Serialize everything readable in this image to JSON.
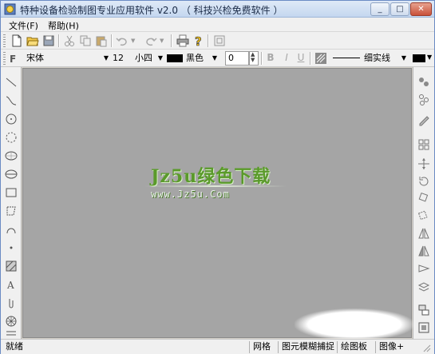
{
  "window": {
    "title": "特种设备检验制图专业应用软件 v2.0 （ 科技兴检免费软件 ）",
    "buttons": {
      "minimize": "_",
      "maximize": "□",
      "close": "✕"
    }
  },
  "menu": {
    "items": [
      {
        "label": "文件(F)"
      },
      {
        "label": "帮助(H)"
      }
    ]
  },
  "toolbar1": {
    "icons": [
      "new-file-icon",
      "open-folder-icon",
      "save-icon",
      "cut-icon",
      "copy-icon",
      "paste-icon",
      "undo-icon",
      "undo-dropdown-icon",
      "redo-icon",
      "redo-dropdown-icon",
      "print-icon",
      "help-icon",
      "page-icon"
    ]
  },
  "toolbar2": {
    "font_name": "宋体",
    "font_size": "12",
    "font_size_name": "小四",
    "color_name": "黑色",
    "spacing_value": "0",
    "bold_label": "B",
    "italic_label": "I",
    "underline_label": "U",
    "line_style": "细实线"
  },
  "canvas": {
    "background": "#a5a5a5",
    "watermark_main": "Jz5u绿色下载",
    "watermark_sub": "www.Jz5u.Com",
    "watermark_color": "#5a9a2a"
  },
  "left_palette": {
    "tools": [
      "line-tool-icon",
      "curve-tool-icon",
      "circle-tool-icon",
      "dashed-circle-tool-icon",
      "ellipse-tool-icon",
      "arc-ellipse-tool-icon",
      "rectangle-tool-icon",
      "polygon-tool-icon",
      "arc-tool-icon",
      "point-tool-icon",
      "hatch-tool-icon",
      "text-tool-icon",
      "clip-tool-icon",
      "wheel-tool-icon",
      "grid-tool-icon"
    ]
  },
  "right_palette": {
    "tools": [
      "scatter-icon",
      "nodes-icon",
      "pencil-icon",
      "align-grid-icon",
      "move-icon",
      "rotate-icon",
      "rotate-alt-icon",
      "mirror-icon",
      "mirror-alt-icon",
      "flip-icon",
      "flip-alt-icon",
      "layers-icon",
      "stack-icon",
      "array-icon"
    ]
  },
  "status": {
    "ready": "就绪",
    "grid": "网格",
    "element_snap": "图元模糊捕捉",
    "drawing_board": "绘图板",
    "image_mode": "图像+"
  }
}
